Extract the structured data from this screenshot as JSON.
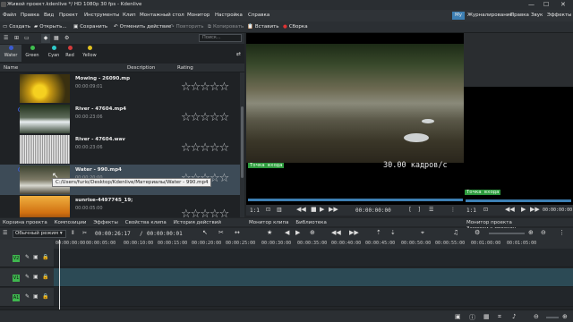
{
  "window": {
    "title": "Живой проект.kdenlive */ HD 1080p 30 fps - Kdenlive",
    "minimize": "—",
    "maximize": "☐",
    "close": "✕"
  },
  "menu": [
    "Файл",
    "Правка",
    "Вид",
    "Проект",
    "Инструменты",
    "Клип",
    "Монтажный стол",
    "Монитор",
    "Настройка",
    "Справка"
  ],
  "workspaces": [
    "My",
    "Журналирование",
    "Правка",
    "Звук",
    "Эффекты"
  ],
  "toolbar": {
    "create": "Создать",
    "open": "Открыть...",
    "save": "Сохранить",
    "undo": "Отменить действие",
    "redo": "Повторить",
    "copy": "Копировать",
    "paste": "Вставить",
    "render": "Сборка"
  },
  "bin": {
    "search_placeholder": "Поиск...",
    "tags": [
      {
        "name": "Water",
        "color": "#3b5bd1"
      },
      {
        "name": "Green",
        "color": "#3fbf4f"
      },
      {
        "name": "Cyan",
        "color": "#2fc9c9"
      },
      {
        "name": "Red",
        "color": "#d23b3b"
      },
      {
        "name": "Yellow",
        "color": "#e0c020"
      }
    ],
    "columns": {
      "name": "Name",
      "description": "Description",
      "rating": "Rating"
    },
    "clips": [
      {
        "name": "Mowing - 26090.mp",
        "duration": "00:00:09:01",
        "stars": "☆☆☆☆☆"
      },
      {
        "name": "River - 47604.mp4",
        "duration": "00:00:23:06",
        "stars": "☆☆☆☆☆"
      },
      {
        "name": "River - 47604.wav",
        "duration": "00:00:23:06",
        "stars": "☆☆☆☆☆"
      },
      {
        "name": "Water - 990.mp4",
        "duration": "00:00:20:00",
        "stars": "☆☆☆☆☆"
      },
      {
        "name": "sunrise-4497745_19;",
        "duration": "00:00:05:00",
        "stars": "☆☆☆☆☆"
      }
    ],
    "tooltip": "C:/Users/furio/Desktop/Kdenlive/Материалы/Water - 990.mp4"
  },
  "left_tabs": [
    "Корзина проекта",
    "Композиции",
    "Эффекты",
    "Свойства клипа",
    "История действий"
  ],
  "clip_monitor": {
    "label": "Точка входа",
    "fps": "30.00 кадров/с",
    "timecode": "00:00:00:00",
    "zoom": "1:1",
    "tab1": "Монитор клипа",
    "tab2": "Библиотека"
  },
  "project_monitor": {
    "label": "Точка входа",
    "zoom": "1:1",
    "timecode": "00:00:00:00",
    "tab1": "Монитор проекта",
    "tab2": "Заметки к проекту"
  },
  "timeline": {
    "mode": "Обычный режим",
    "position": "00:00:26:17",
    "duration": "00:00:00:01",
    "ticks": [
      "00:00:00:00",
      "00:00:05:00",
      "00:00:10:00",
      "00:00:15:00",
      "00:00:20:00",
      "00:00:25:00",
      "00:00:30:00",
      "00:00:35:00",
      "00:00:40:00",
      "00:00:45:00",
      "00:00:50:00",
      "00:00:55:00",
      "00:01:00:00",
      "00:01:05:00"
    ],
    "tracks": [
      {
        "label": "V2",
        "color": "#3fb64f"
      },
      {
        "label": "V1",
        "color": "#3fb64f"
      },
      {
        "label": "A1",
        "color": "#3fb64f"
      }
    ]
  }
}
